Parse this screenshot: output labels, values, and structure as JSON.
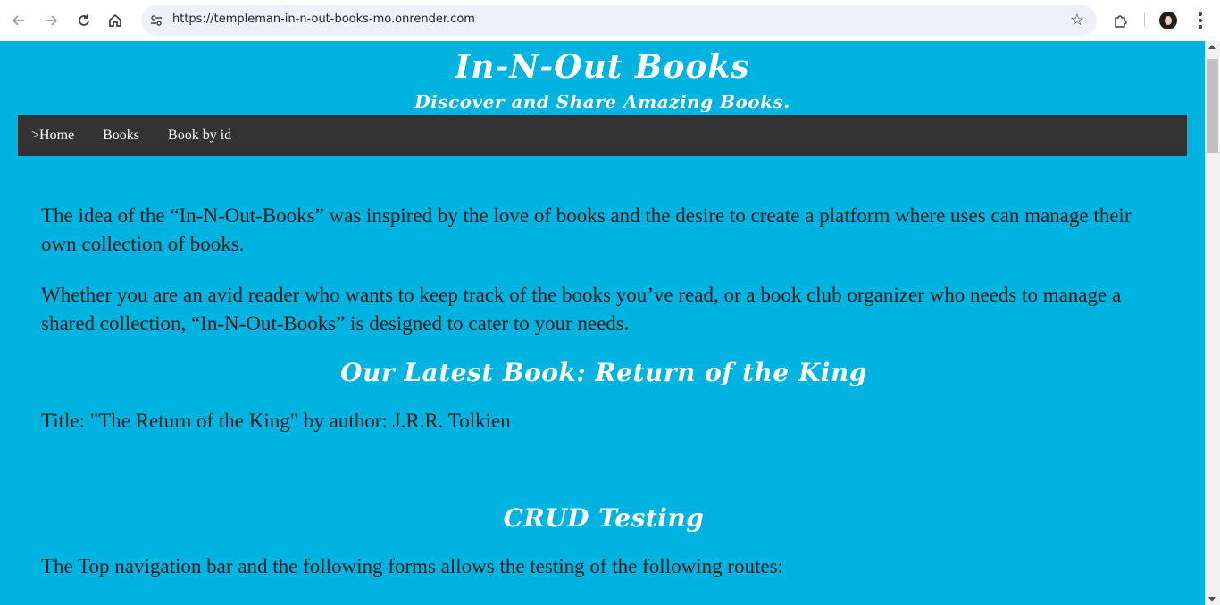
{
  "browser": {
    "url": "https://templeman-in-n-out-books-mo.onrender.com",
    "back_icon": "back-arrow-icon",
    "forward_icon": "forward-arrow-icon",
    "reload_icon": "reload-icon",
    "home_icon": "home-icon",
    "site_info_icon": "tune-icon",
    "bookmark_icon": "star-icon",
    "extensions_icon": "puzzle-icon",
    "menu_icon": "kebab-menu-icon"
  },
  "header": {
    "title": "In-N-Out Books",
    "subtitle": "Discover and Share Amazing Books."
  },
  "nav": {
    "items": [
      {
        "label": ">Home"
      },
      {
        "label": "Books"
      },
      {
        "label": "Book by id"
      }
    ]
  },
  "main": {
    "intro_1": "The idea of the “In-N-Out-Books” was inspired by the love of books and the desire to create a platform where uses can manage their own collection of books.",
    "intro_2": "Whether you are an avid reader who wants to keep track of the books you’ve read, or a book club organizer who needs to manage a shared collection, “In-N-Out-Books” is designed to cater to your needs.",
    "latest_heading": "Our Latest Book: Return of the King",
    "latest_text": "Title: \"The Return of the King\" by author: J.R.R. Tolkien",
    "crud_heading": "CRUD Testing",
    "crud_text": "The Top navigation bar and the following forms allows the testing of the following routes:"
  },
  "colors": {
    "page_background": "#00b3e0",
    "nav_background": "#333333",
    "heading_text": "#ffffff",
    "body_text": "#1a1a1a"
  }
}
